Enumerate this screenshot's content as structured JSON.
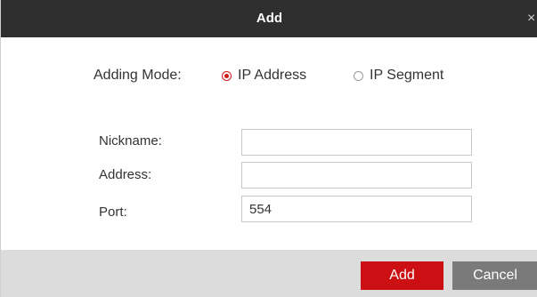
{
  "dialog": {
    "title": "Add",
    "close_glyph": "×"
  },
  "adding_mode": {
    "label": "Adding Mode:",
    "options": [
      {
        "label": "IP Address",
        "selected": true
      },
      {
        "label": "IP Segment",
        "selected": false
      }
    ]
  },
  "form": {
    "nickname": {
      "label": "Nickname:",
      "value": ""
    },
    "address": {
      "label": "Address:",
      "value": ""
    },
    "port": {
      "label": "Port:",
      "value": "554"
    }
  },
  "footer": {
    "add_label": "Add",
    "cancel_label": "Cancel"
  },
  "colors": {
    "titlebar": "#2f2f2f",
    "accent_red": "#cc0f12",
    "cancel_gray": "#7a7a7a",
    "footer_bg": "#dcdcdc"
  }
}
